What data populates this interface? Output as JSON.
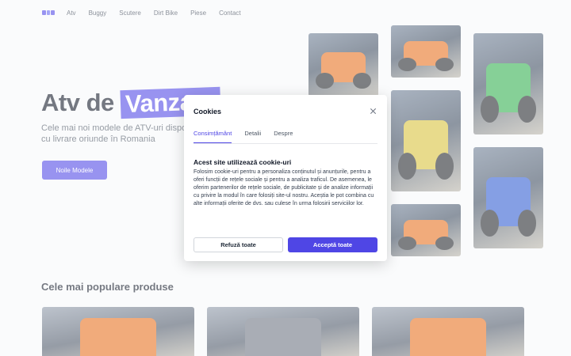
{
  "nav": {
    "logo_colors": [
      "#4f46e5",
      "#6366f1",
      "#4f46e5"
    ],
    "links": [
      "Atv",
      "Buggy",
      "Scutere",
      "Dirt Bike",
      "Piese",
      "Contact"
    ]
  },
  "hero": {
    "title_part1": "Atv de ",
    "title_highlight": "Vanzare",
    "subtitle": "Cele mai noi modele de ATV-uri disponibile cu livrare oriunde în Romania",
    "button_label": "Noile Modele"
  },
  "gallery": {
    "accent_colors": [
      "#e76f1c",
      "#e76f1c",
      "#2fae4d",
      "#3a6fd8",
      "#d8c23a",
      "#2e5bd0",
      "#e76f1c"
    ]
  },
  "popular": {
    "title": "Cele mai populare produse"
  },
  "cookie_modal": {
    "title": "Cookies",
    "tabs": [
      "Consimțământ",
      "Detalii",
      "Despre"
    ],
    "active_tab": "Consimțământ",
    "heading": "Acest site utilizează cookie-uri",
    "text": "Folosim cookie-uri pentru a personaliza conținutul și anunțurile, pentru a oferi funcții de rețele sociale și pentru a analiza traficul. De asemenea, le oferim partenerilor de rețele sociale, de publicitate și de analize informații cu privire la modul în care folosiți site-ul nostru. Aceștia le pot combina cu alte informații oferite de dvs. sau culese în urma folosirii serviciilor lor.",
    "reject_label": "Refuză toate",
    "accept_label": "Acceptă toate",
    "accent_color": "#4f46e5"
  }
}
